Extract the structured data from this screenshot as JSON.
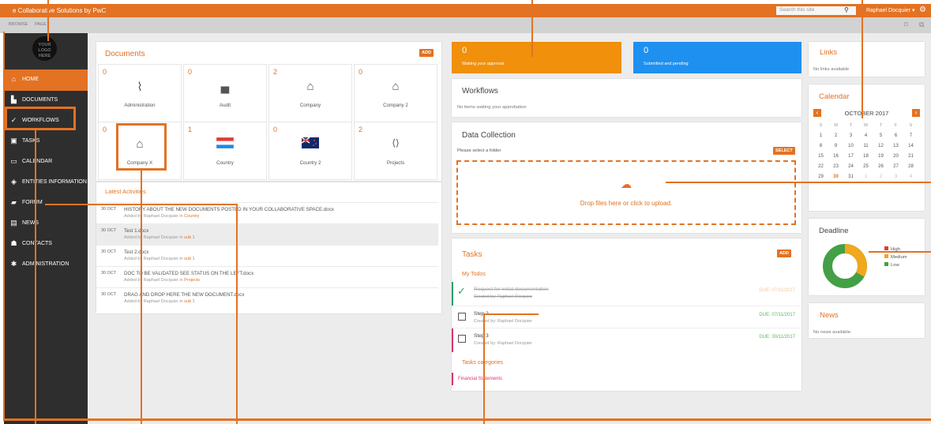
{
  "topbar": {
    "title": "e Collaborative Solutions by PwC",
    "search_placeholder": "Search this site",
    "user": "Raphael Docquier ▾"
  },
  "ribbon": {
    "browse": "BROWSE",
    "page": "PAGE"
  },
  "logo_text": "YOUR LOGO HERE",
  "sidebar": {
    "items": [
      {
        "label": "HOME",
        "icon": "home-icon"
      },
      {
        "label": "DOCUMENTS",
        "icon": "document-icon"
      },
      {
        "label": "WORKFLOWS",
        "icon": "workflow-icon"
      },
      {
        "label": "TASKS",
        "icon": "clipboard-icon"
      },
      {
        "label": "CALENDAR",
        "icon": "calendar-icon"
      },
      {
        "label": "ENTITIES INFORMATION",
        "icon": "cube-icon"
      },
      {
        "label": "FORUM",
        "icon": "chat-icon"
      },
      {
        "label": "NEWS",
        "icon": "newspaper-icon"
      },
      {
        "label": "CONTACTS",
        "icon": "people-icon"
      },
      {
        "label": "ADMINISTRATION",
        "icon": "gear-icon"
      }
    ]
  },
  "documents": {
    "title": "Documents",
    "add": "ADD",
    "tiles": [
      {
        "count": "0",
        "label": "Administration",
        "icon": "paperclip-icon"
      },
      {
        "count": "0",
        "label": "Audit",
        "icon": "briefcase-icon"
      },
      {
        "count": "2",
        "label": "Company",
        "icon": "house-icon"
      },
      {
        "count": "0",
        "label": "Company 2",
        "icon": "house-icon"
      },
      {
        "count": "0",
        "label": "Company X",
        "icon": "house-icon"
      },
      {
        "count": "1",
        "label": "Country",
        "icon": "flag-icon"
      },
      {
        "count": "0",
        "label": "Country 2",
        "icon": "flag-icon"
      },
      {
        "count": "2",
        "label": "Projects",
        "icon": "code-icon"
      }
    ]
  },
  "activities": {
    "title": "Latest Activities",
    "items": [
      {
        "date": "30 OCT",
        "title": "HISTORY ABOUT THE NEW DOCUMENTS POSTED IN YOUR COLLABORATIVE SPACE.docx",
        "by": "Added by Raphael Docquier in ",
        "where": "Country"
      },
      {
        "date": "30 OCT",
        "title": "Test 1.docx",
        "by": "Added by Raphael Docquier in ",
        "where": "sub 1"
      },
      {
        "date": "30 OCT",
        "title": "Test 2.docx",
        "by": "Added by Raphael Docquier in ",
        "where": "sub 1"
      },
      {
        "date": "30 OCT",
        "title": "DOC TO BE VALIDATED SEE STATUS ON THE LEFT.docx",
        "by": "Added by Raphael Docquier in ",
        "where": "Projects"
      },
      {
        "date": "30 OCT",
        "title": "DRAG AND DROP HERE THE NEW DOCUMENT.docx",
        "by": "Added by Raphael Docquier in ",
        "where": "sub 1"
      }
    ]
  },
  "stats": {
    "waiting": {
      "count": "0",
      "label": "Waiting your approval",
      "color": "#f0900b"
    },
    "submitted": {
      "count": "0",
      "label": "Submitted and pending",
      "color": "#1e90f0"
    }
  },
  "workflows": {
    "title": "Workflows",
    "empty": "No items waiting your approbation"
  },
  "data_collection": {
    "title": "Data Collection",
    "prompt": "Please select a folder",
    "select": "SELECT",
    "drop": "Drop files here or click to upload."
  },
  "tasks": {
    "title": "Tasks",
    "add": "ADD",
    "todos_title": "My Todos",
    "items": [
      {
        "name": "Request for initial documentation",
        "by": "Created by: Raphael Docquier",
        "due": "DUE: 07/11/2017",
        "done": true
      },
      {
        "name": "Step 2",
        "by": "Created by: Raphael Docquier",
        "due": "DUE: 07/11/2017",
        "done": false
      },
      {
        "name": "Step 3",
        "by": "Created by: Raphael Docquier",
        "due": "DUE: 30/11/2017",
        "done": false
      }
    ],
    "categories_title": "Tasks categories",
    "categories": [
      "Financial Statements"
    ]
  },
  "links": {
    "title": "Links",
    "empty": "No links available"
  },
  "calendar": {
    "title": "Calendar",
    "month": "OCTOBER 2017",
    "weekdays": [
      "S",
      "M",
      "T",
      "W",
      "T",
      "F",
      "S"
    ],
    "weeks": [
      [
        "1",
        "2",
        "3",
        "4",
        "5",
        "6",
        "7"
      ],
      [
        "8",
        "9",
        "10",
        "11",
        "12",
        "13",
        "14"
      ],
      [
        "15",
        "16",
        "17",
        "18",
        "19",
        "20",
        "21"
      ],
      [
        "22",
        "23",
        "24",
        "25",
        "26",
        "27",
        "28"
      ],
      [
        "29",
        "30",
        "31",
        "1",
        "2",
        "3",
        "4"
      ]
    ],
    "today": "30"
  },
  "deadline": {
    "title": "Deadline",
    "legend": [
      {
        "label": "High",
        "color": "#e53935"
      },
      {
        "label": "Medium",
        "color": "#f0a81e"
      },
      {
        "label": "Low",
        "color": "#43a047"
      }
    ],
    "shares": {
      "high": 0,
      "medium": 0.33,
      "low": 0.67
    }
  },
  "news": {
    "title": "News",
    "empty": "No news available"
  },
  "colors": {
    "accent": "#e37222",
    "sidebar": "#2e2e2e"
  }
}
